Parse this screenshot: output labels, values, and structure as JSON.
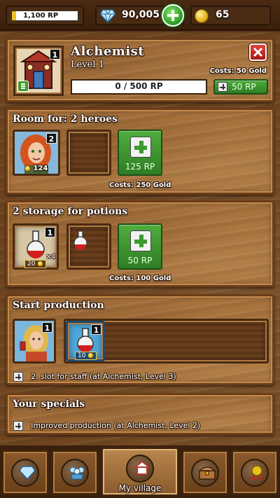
{
  "topbar": {
    "rp_value": "1,100 RP",
    "gems": "90,005",
    "gold": "65"
  },
  "building": {
    "name": "Alchemist",
    "level": "Level 1",
    "badge": "1",
    "progress_text": "0 / 500 RP",
    "progress_fraction": 0,
    "cost_text": "Costs: 50 Gold",
    "upgrade_label": "50 RP"
  },
  "heroes": {
    "title": "Room for: 2 heroes",
    "hero_badge": "2",
    "hero_value": "124",
    "add_label": "125 RP",
    "cost_text": "Costs: 250 Gold"
  },
  "storage": {
    "title": "2 storage for potions",
    "slot_badge": "1",
    "multiplier": "×4",
    "price": "20",
    "add_label": "50 RP",
    "cost_text": "Costs: 100 Gold"
  },
  "production": {
    "title": "Start production",
    "staff_badge": "1",
    "potion_badge": "1",
    "potion_price": "10",
    "note": "2. slot for staff (at Alchemist, Level 3)"
  },
  "specials": {
    "title": "Your specials",
    "note": "Improved production (at Alchemist, Level 2)"
  },
  "nav": {
    "village_label": "My village"
  },
  "colors": {
    "accent_green": "#2f7d24",
    "close_red": "#c8231b",
    "panel_border": "#6b3d18"
  }
}
